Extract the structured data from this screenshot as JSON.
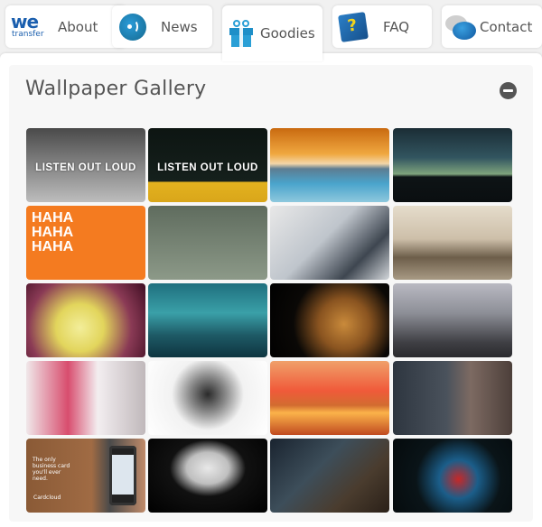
{
  "tabs": [
    {
      "label": "About",
      "icon": "wetransfer-logo-icon",
      "logo_text": "we",
      "logo_sub": "transfer",
      "active": false
    },
    {
      "label": "News",
      "icon": "broadcast-icon",
      "active": false
    },
    {
      "label": "Goodies",
      "icon": "gift-icon",
      "active": true
    },
    {
      "label": "FAQ",
      "icon": "help-book-icon",
      "icon_glyph": "?",
      "active": false
    },
    {
      "label": "Contact",
      "icon": "speech-bubbles-icon",
      "active": false
    }
  ],
  "gallery": {
    "title": "Wallpaper Gallery",
    "collapse_icon": "minus-circle-icon",
    "items": [
      {
        "name": "listen-out-loud-skeleton",
        "caption": "LISTEN OUT LOUD",
        "bg": "linear-gradient(#4a4a4a,#bdbdbd)"
      },
      {
        "name": "listen-out-loud-singers",
        "caption": "LISTEN OUT LOUD",
        "bg": "linear-gradient(#0d1512 0%,#15201c 72%,#e3b21f 73%,#d9a61a 100%)"
      },
      {
        "name": "infinity-pool-sunset",
        "caption": "",
        "bg": "linear-gradient(#c96a10 0%,#f0a840 35%,#f3d6a8 48%,#5d7d92 55%,#4aa4cc 75%,#8ec8dd 100%)"
      },
      {
        "name": "rooftop-silhouette",
        "caption": "",
        "bg": "linear-gradient(#1b2d35 0%,#325560 40%,#7ea37c 62%,#0e1416 66%,#0a0e10 100%)"
      },
      {
        "name": "hahaha-waldisney",
        "caption": "",
        "bg": "#f47b20"
      },
      {
        "name": "robot-city-illustration",
        "caption": "",
        "bg": "linear-gradient(#5f6c5e,#8c9988)"
      },
      {
        "name": "bottles-closeup",
        "caption": "",
        "bg": "linear-gradient(135deg,#e8e8e8,#bfc5cc 45%,#3e4650 75%,#d2d6da)"
      },
      {
        "name": "bridge-cityscape",
        "caption": "",
        "bg": "linear-gradient(#e5dccb 0%,#cdbfa9 45%,#6d5e4a 70%,#a89a84 100%)"
      },
      {
        "name": "yellow-ink-cloud",
        "caption": "",
        "bg": "radial-gradient(circle at 45% 60%,#f3ee9a 0%,#e2d55c 30%,#8a3a55 65%,#3e0d22 100%)"
      },
      {
        "name": "surfer-wave",
        "caption": "",
        "bg": "linear-gradient(#1f6f7e 0%,#3aa0a8 40%,#1e5a66 70%,#0e3540 100%)"
      },
      {
        "name": "lion-portrait",
        "caption": "",
        "bg": "radial-gradient(circle at 62% 55%,#c98a3b 0%,#8a5420 30%,#0a0806 60%,#000 100%)"
      },
      {
        "name": "statue-architecture",
        "caption": "",
        "bg": "linear-gradient(#b9b9c2 0%,#8d8f97 40%,#3f3f44 80%,#2a2a2e 100%)"
      },
      {
        "name": "sketch-portraits",
        "caption": "",
        "bg": "linear-gradient(90deg,#f0e8ea 0%,#d84d6e 35%,#f3eef0 60%,#c0b8bb 100%)"
      },
      {
        "name": "masked-woman-bw",
        "caption": "",
        "bg": "radial-gradient(circle at 50% 45%,#2a2a2a 0%,#8a8a8a 25%,#f2f2f2 50%,#fff 100%)"
      },
      {
        "name": "man-at-sunset",
        "caption": "",
        "bg": "linear-gradient(#f0a06a 0%,#f05a3a 40%,#d26c30 60%,#fbb34a 70%,#c04a20 100%)"
      },
      {
        "name": "woman-in-scarf",
        "caption": "",
        "bg": "linear-gradient(90deg,#2e3640 0%,#4a525c 45%,#7d6a62 65%,#4c3f3a 100%)"
      },
      {
        "name": "cardcloud-phone",
        "caption": "",
        "bg": "linear-gradient(90deg,#8a5a36 0%,#a06b44 55%,#4a4a4a 70%,#c08b6a 100%)"
      },
      {
        "name": "italian-helmet",
        "caption": "",
        "bg": "radial-gradient(ellipse at 50% 40%,#e8e8e8 0%,#bfbfbf 25%,#111 45%,#000 100%)"
      },
      {
        "name": "forest-balloons",
        "caption": "",
        "bg": "linear-gradient(135deg,#1a2430 0%,#3d4e5a 40%,#4a3c2e 70%,#2a2018 100%)"
      },
      {
        "name": "light-trails",
        "caption": "",
        "bg": "radial-gradient(circle at 55% 55%,#c62828 0%,#1b5e8a 25%,#0a1418 55%,#050a0c 100%)"
      }
    ],
    "cardcloud_text": "The only business card you'll ever need.",
    "cardcloud_brand": "Cardcloud"
  }
}
